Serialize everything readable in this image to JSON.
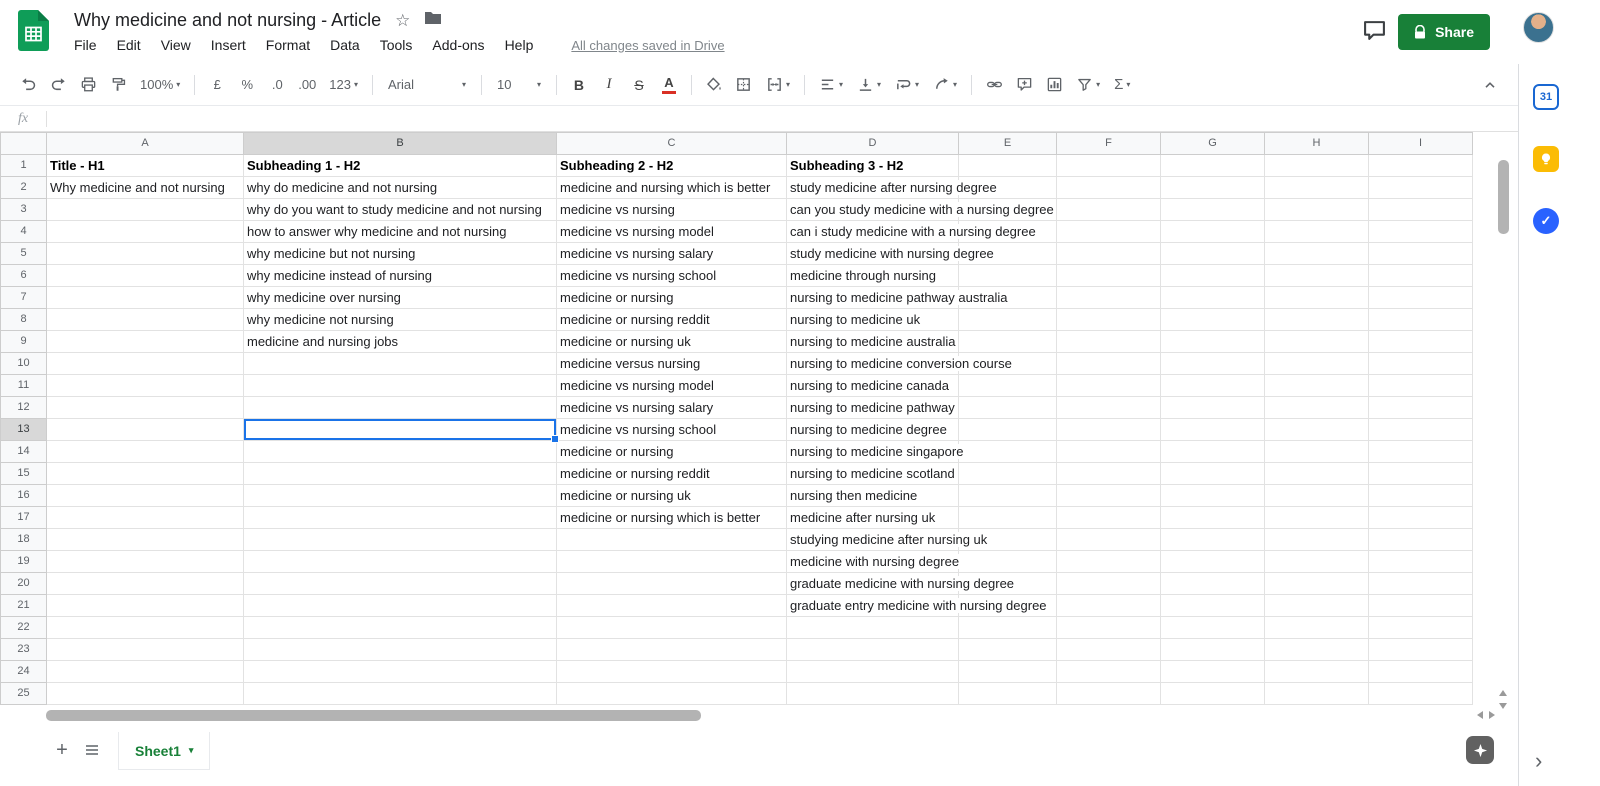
{
  "header": {
    "title": "Why medicine and not nursing - Article",
    "menu": [
      "File",
      "Edit",
      "View",
      "Insert",
      "Format",
      "Data",
      "Tools",
      "Add-ons",
      "Help"
    ],
    "saved_status": "All changes saved in Drive",
    "share_label": "Share"
  },
  "icons": {
    "caret": "▾",
    "star": "☆",
    "plus": "+",
    "check": "✓",
    "chevron_right": "›"
  },
  "toolbar": {
    "zoom": "100%",
    "currency": "£",
    "percent": "%",
    "decimal_decrease": ".0",
    "decimal_increase": ".00",
    "more_formats": "123",
    "font": "Arial",
    "font_size": "10",
    "bold": "B",
    "italic": "I",
    "strikethrough": "S",
    "text_color": "A",
    "functions": "Σ"
  },
  "formula_bar": {
    "fx_label": "fx",
    "value": ""
  },
  "grid": {
    "columns": [
      "A",
      "B",
      "C",
      "D",
      "E",
      "F",
      "G",
      "H",
      "I"
    ],
    "row_count": 25,
    "selection": "B13",
    "cells": {
      "A": [
        "Title - H1",
        "Why medicine and not nursing"
      ],
      "B": [
        "Subheading 1 - H2",
        "why do medicine and not nursing",
        "why do you want to study medicine and not nursing",
        "how to answer why medicine and not nursing",
        "why medicine but not nursing",
        "why medicine instead of nursing",
        "why medicine over nursing",
        "why medicine not nursing",
        "medicine and nursing jobs"
      ],
      "C": [
        "Subheading 2 - H2",
        "medicine and nursing which is better",
        "medicine vs nursing",
        "medicine vs nursing model",
        "medicine vs nursing salary",
        "medicine vs nursing school",
        "medicine or nursing",
        "medicine or nursing reddit",
        "medicine or nursing uk",
        "medicine versus nursing",
        "medicine vs nursing model",
        "medicine vs nursing salary",
        "medicine vs nursing school",
        "medicine or nursing",
        "medicine or nursing reddit",
        "medicine or nursing uk",
        "medicine or nursing which is better"
      ],
      "D": [
        "Subheading 3 - H2",
        "study medicine after nursing degree",
        "can you study medicine with a nursing degree",
        "can i study medicine with a nursing degree",
        "study medicine with nursing degree",
        "medicine through nursing",
        "nursing to medicine pathway australia",
        "nursing to medicine uk",
        "nursing to medicine australia",
        "nursing to medicine conversion course",
        "nursing to medicine canada",
        "nursing to medicine pathway",
        "nursing to medicine degree",
        "nursing to medicine singapore",
        "nursing to medicine scotland",
        "nursing then medicine",
        "medicine after nursing uk",
        "studying medicine after nursing uk",
        "medicine with nursing degree",
        "graduate medicine with nursing degree",
        "graduate entry medicine with nursing degree"
      ]
    }
  },
  "sheet_bar": {
    "active_tab": "Sheet1"
  },
  "side_panel": {
    "calendar_label": "31"
  }
}
